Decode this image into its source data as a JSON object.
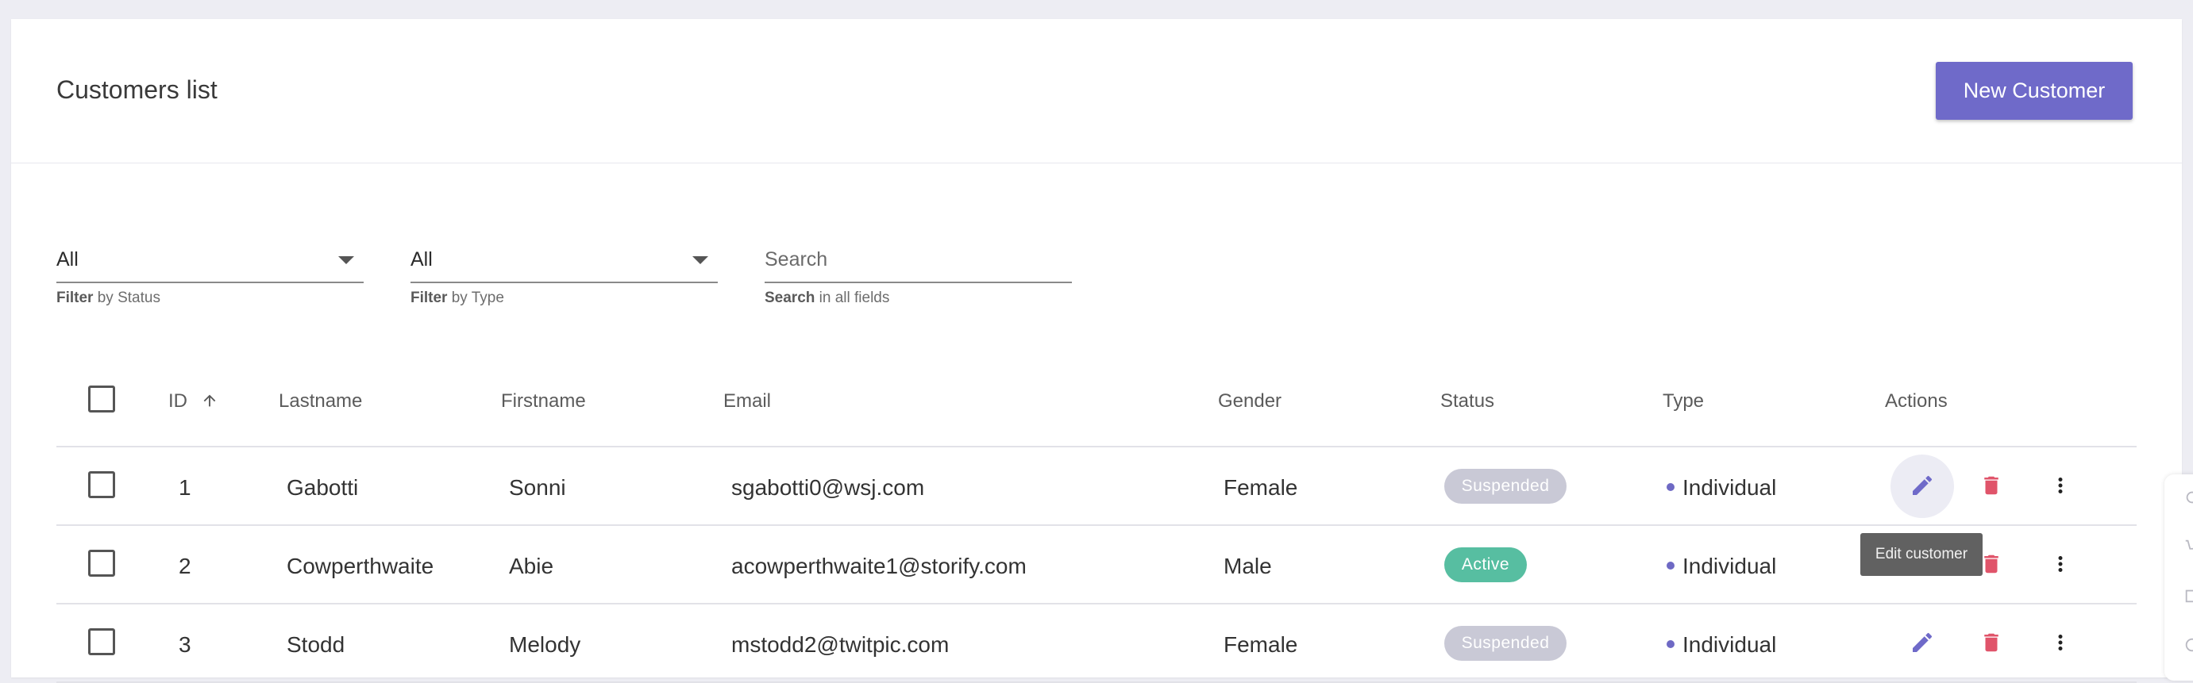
{
  "header": {
    "title": "Customers list",
    "new_button": "New Customer"
  },
  "filters": [
    {
      "value": "All",
      "helper_bold": "Filter",
      "helper_rest": " by Status"
    },
    {
      "value": "All",
      "helper_bold": "Filter",
      "helper_rest": " by Type"
    },
    {
      "placeholder": "Search",
      "helper_bold": "Search",
      "helper_rest": " in all fields"
    }
  ],
  "table": {
    "columns": {
      "id": "ID",
      "lastname": "Lastname",
      "firstname": "Firstname",
      "email": "Email",
      "gender": "Gender",
      "status": "Status",
      "type": "Type",
      "actions": "Actions"
    },
    "sort": {
      "column": "ID",
      "direction": "ascending",
      "icon": "arrow-up-icon"
    },
    "rows": [
      {
        "id": "1",
        "lastname": "Gabotti",
        "firstname": "Sonni",
        "email": "sgabotti0@wsj.com",
        "gender": "Female",
        "status": "Suspended",
        "type": "Individual"
      },
      {
        "id": "2",
        "lastname": "Cowperthwaite",
        "firstname": "Abie",
        "email": "acowperthwaite1@storify.com",
        "gender": "Male",
        "status": "Active",
        "type": "Individual"
      },
      {
        "id": "3",
        "lastname": "Stodd",
        "firstname": "Melody",
        "email": "mstodd2@twitpic.com",
        "gender": "Female",
        "status": "Suspended",
        "type": "Individual"
      }
    ]
  },
  "tooltip": "Edit customer",
  "colors": {
    "accent": "#6f6ac9",
    "delete": "#e0546a",
    "active": "#57bea1",
    "suspended": "#c9c9d6"
  },
  "icons": [
    "arrow-up-icon",
    "pencil-icon",
    "trash-icon",
    "more-vertical-icon",
    "chevron-down-icon"
  ]
}
